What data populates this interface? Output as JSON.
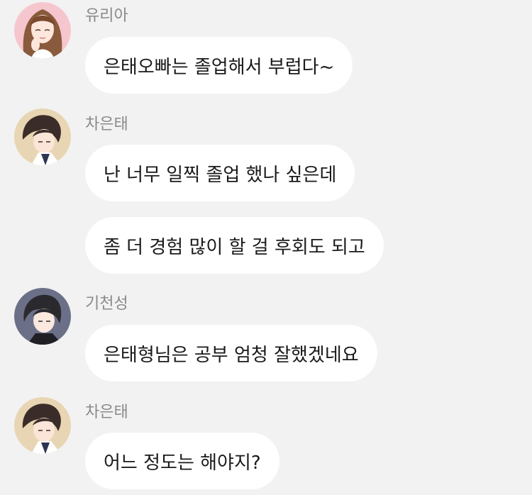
{
  "colors": {
    "background": "#f2f2f2",
    "bubble": "#ffffff",
    "sender_text": "#8a8a8a",
    "message_text": "#1a1a1a"
  },
  "messages": [
    {
      "sender": "유리아",
      "avatar": "yuria-avatar",
      "texts": [
        "은태오빠는 졸업해서 부럽다~"
      ]
    },
    {
      "sender": "차은태",
      "avatar": "euntae-avatar",
      "texts": [
        "난 너무 일찍 졸업 했나 싶은데",
        "좀 더 경험 많이 할 걸 후회도 되고"
      ]
    },
    {
      "sender": "기천성",
      "avatar": "cheonsung-avatar",
      "texts": [
        "은태형님은 공부 엄청 잘했겠네요"
      ]
    },
    {
      "sender": "차은태",
      "avatar": "euntae-avatar",
      "texts": [
        "어느 정도는 해야지?"
      ]
    }
  ]
}
